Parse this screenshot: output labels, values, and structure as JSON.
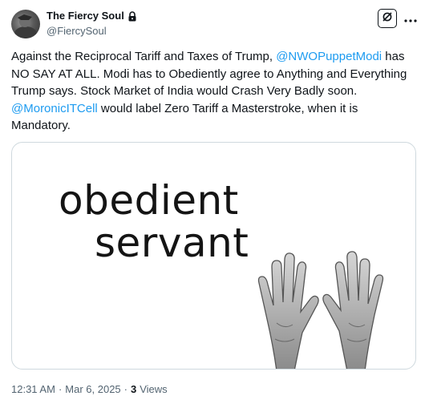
{
  "author": {
    "display_name": "The Fiercy Soul",
    "handle": "@FiercySoul",
    "protected_icon": "lock-icon",
    "avatar_icon": "avatar-photo"
  },
  "toolbar": {
    "grok_icon": "grok-icon",
    "more_icon": "more-horizontal-icon"
  },
  "tweet": {
    "text_1": "Against the Reciprocal Tariff and Taxes of Trump, ",
    "mention_1": "@NWOPuppetModi",
    "text_2": " has NO SAY AT ALL. Modi has to Obediently agree to Anything and Everything Trump says. Stock Market of India would Crash Very Badly soon. ",
    "mention_2": "@MoronicITCell",
    "text_3": " would label Zero Tariff a Masterstroke, when it is Mandatory."
  },
  "media": {
    "line_1": "obedient",
    "line_2": "servant",
    "illustration": "raised-hands-illustration"
  },
  "meta": {
    "time": "12:31 AM",
    "separator": "·",
    "date": "Mar 6, 2025",
    "views_count": "3",
    "views_label": "Views"
  },
  "colors": {
    "link": "#1d9bf0",
    "text": "#0f1419",
    "secondary": "#536471",
    "border": "#cfd9de"
  }
}
